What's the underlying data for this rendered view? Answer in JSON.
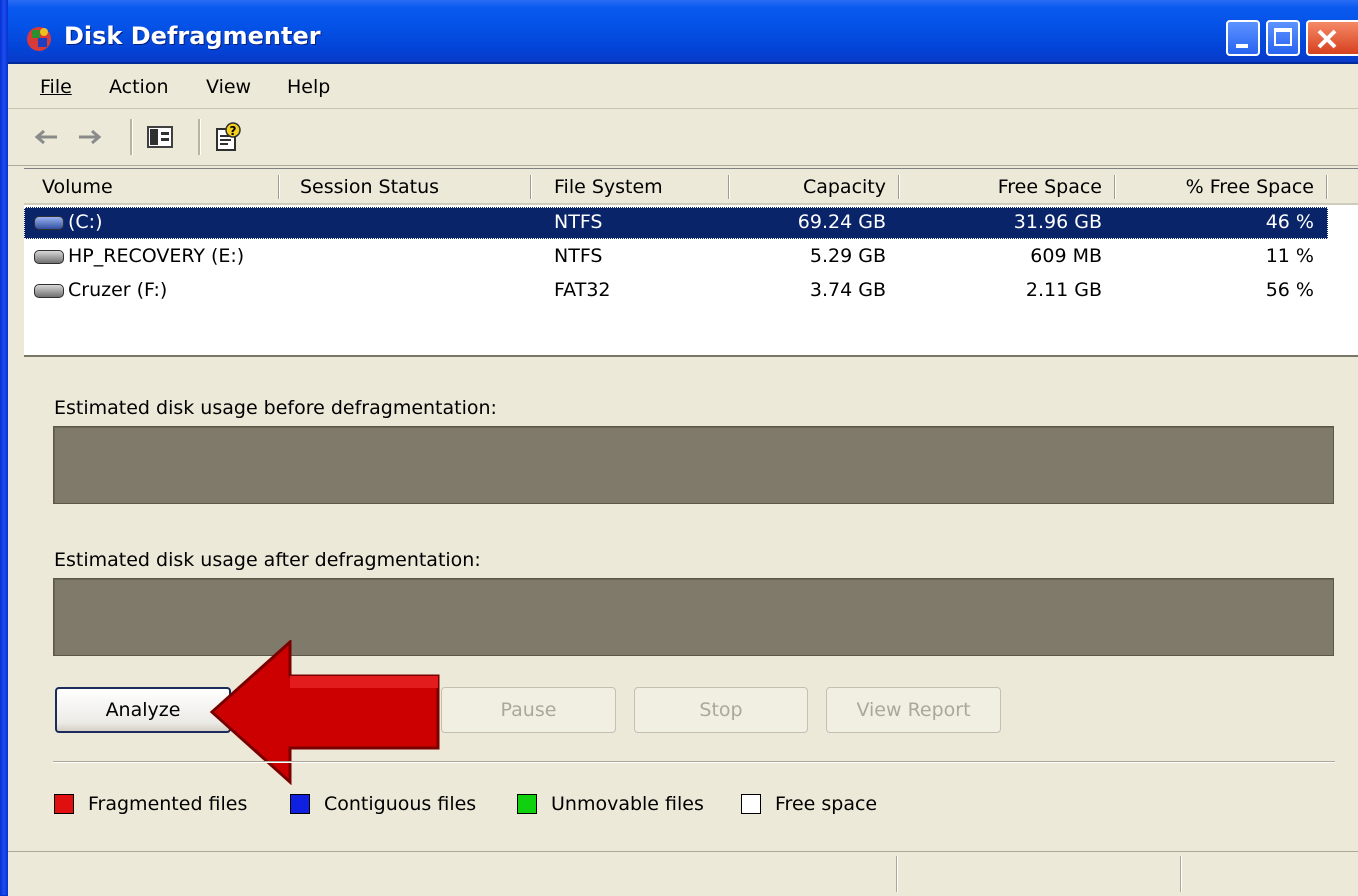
{
  "window": {
    "title": "Disk Defragmenter"
  },
  "menu": {
    "items": [
      {
        "label": "File"
      },
      {
        "label": "Action"
      },
      {
        "label": "View"
      },
      {
        "label": "Help"
      }
    ]
  },
  "toolbar": {
    "icons": [
      "back-arrow-icon",
      "forward-arrow-icon",
      "show-hide-console-tree-icon",
      "help-icon"
    ]
  },
  "volumes": {
    "columns": [
      "Volume",
      "Session Status",
      "File System",
      "Capacity",
      "Free Space",
      "% Free Space"
    ],
    "rows": [
      {
        "volume": "(C:)",
        "status": "",
        "fs": "NTFS",
        "capacity": "69.24 GB",
        "free": "31.96 GB",
        "pct": "46 %",
        "selected": true
      },
      {
        "volume": "HP_RECOVERY (E:)",
        "status": "",
        "fs": "NTFS",
        "capacity": "5.29 GB",
        "free": "609 MB",
        "pct": "11 %",
        "selected": false
      },
      {
        "volume": "Cruzer (F:)",
        "status": "",
        "fs": "FAT32",
        "capacity": "3.74 GB",
        "free": "2.11 GB",
        "pct": "56 %",
        "selected": false
      }
    ]
  },
  "panel": {
    "before_label": "Estimated disk usage before defragmentation:",
    "after_label": "Estimated disk usage after defragmentation:"
  },
  "buttons": {
    "analyze": "Analyze",
    "pause": "Pause",
    "stop": "Stop",
    "view_report": "View Report"
  },
  "legend": [
    {
      "label": "Fragmented files",
      "color": "#e01010"
    },
    {
      "label": "Contiguous files",
      "color": "#1020e0"
    },
    {
      "label": "Unmovable files",
      "color": "#10d010"
    },
    {
      "label": "Free space",
      "color": "#ffffff"
    }
  ],
  "colors": {
    "selection": "#0a246a",
    "usage_bar": "#807a6a",
    "arrow": "#cc0000"
  }
}
